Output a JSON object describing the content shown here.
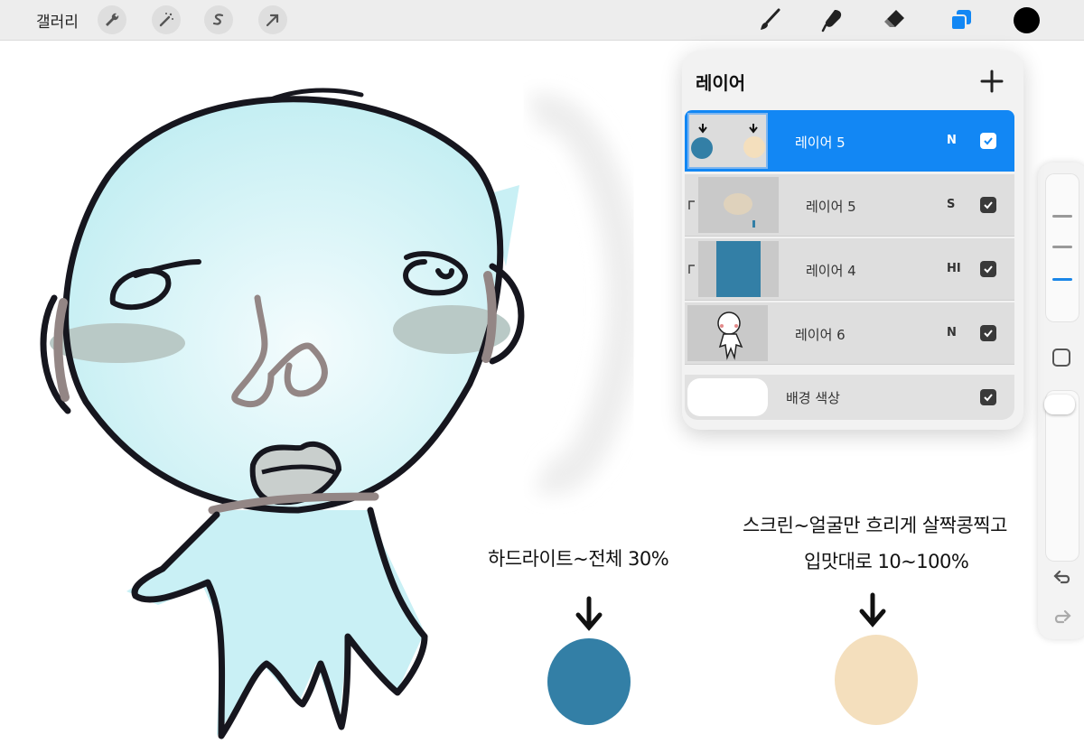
{
  "toolbar": {
    "gallery_label": "갤러리",
    "left_tools": [
      "wrench-icon",
      "magic-wand-icon",
      "selection-icon",
      "transform-arrow-icon"
    ],
    "right_tools": [
      "brush-icon",
      "smudge-icon",
      "eraser-icon",
      "layers-icon"
    ],
    "active_color": "#000000",
    "accent": "#1287f4"
  },
  "layers_panel": {
    "title": "레이어",
    "layers": [
      {
        "name": "레이어 5",
        "blend": "N",
        "visible": true,
        "selected": true,
        "clipped": false
      },
      {
        "name": "레이어 5",
        "blend": "S",
        "visible": true,
        "selected": false,
        "clipped": true
      },
      {
        "name": "레이어 4",
        "blend": "HI",
        "visible": true,
        "selected": false,
        "clipped": true
      },
      {
        "name": "레이어 6",
        "blend": "N",
        "visible": true,
        "selected": false,
        "clipped": false
      }
    ],
    "background": {
      "label": "배경 색상",
      "visible": true,
      "color": "#ffffff"
    }
  },
  "canvas": {
    "note_left": "하드라이트~전체 30%",
    "note_right_line1": "스크린~얼굴만 흐리게 살짝콩찍고",
    "note_right_line2": "입맛대로 10~100%",
    "swatch_blue": "#337fa6",
    "swatch_peach": "#f4dfbd"
  },
  "sidebar": {
    "brush_size_marks": 3,
    "tools": [
      "modify-square-icon",
      "undo-icon",
      "redo-icon"
    ]
  }
}
